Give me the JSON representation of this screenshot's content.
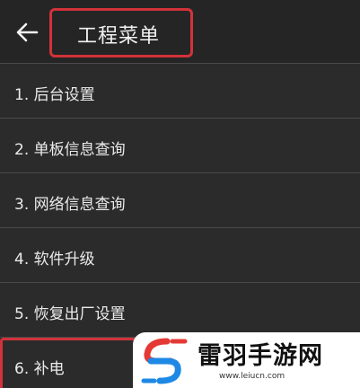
{
  "appbar": {
    "back_icon": "arrow-left-icon",
    "title": "工程菜单"
  },
  "menu": {
    "items": [
      {
        "label": "1. 后台设置"
      },
      {
        "label": "2. 单板信息查询"
      },
      {
        "label": "3. 网络信息查询"
      },
      {
        "label": "4. 软件升级"
      },
      {
        "label": "5. 恢复出厂设置"
      },
      {
        "label": "6. 补电"
      }
    ]
  },
  "watermark": {
    "name": "雷羽手游网",
    "url": "www.leiucn.com"
  },
  "colors": {
    "background": "#2b2b2b",
    "appbar": "#252525",
    "highlight": "#d2323a",
    "logo_red": "#e53935",
    "logo_blue": "#1e88e5",
    "text": "#ebebeb"
  }
}
